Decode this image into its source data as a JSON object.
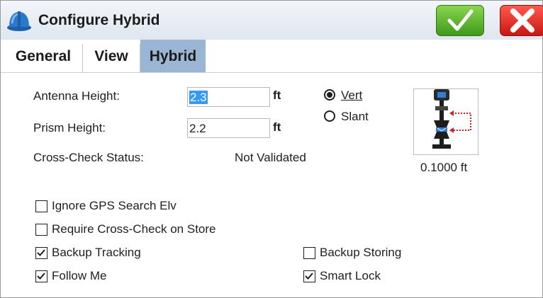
{
  "window": {
    "title": "Configure Hybrid"
  },
  "toolbar": {
    "ok_icon": "checkmark-icon",
    "close_icon": "close-x-icon"
  },
  "tabs": [
    {
      "label": "General",
      "active": false
    },
    {
      "label": "View",
      "active": false
    },
    {
      "label": "Hybrid",
      "active": true
    }
  ],
  "form": {
    "antenna_height_label": "Antenna Height:",
    "antenna_height_value": "2.3",
    "antenna_height_unit": "ft",
    "prism_height_label": "Prism Height:",
    "prism_height_value": "2.2",
    "prism_height_unit": "ft",
    "cross_check_label": "Cross-Check Status:",
    "cross_check_value": "Not Validated",
    "height_mode": {
      "vert_label": "Vert",
      "slant_label": "Slant",
      "selected": "Vert"
    },
    "offset_value": "0.1000 ft"
  },
  "options": {
    "ignore_gps": {
      "label": "Ignore GPS Search Elv",
      "checked": false
    },
    "require_cross_check": {
      "label": "Require Cross-Check on Store",
      "checked": false
    },
    "backup_tracking": {
      "label": "Backup Tracking",
      "checked": true
    },
    "backup_storing": {
      "label": "Backup Storing",
      "checked": false
    },
    "follow_me": {
      "label": "Follow Me",
      "checked": true
    },
    "smart_lock": {
      "label": "Smart Lock",
      "checked": true
    }
  },
  "colors": {
    "active_tab": "#9ab6d4",
    "ok_green": "#4caf28",
    "close_red": "#e0261e",
    "selection": "#3399ff"
  }
}
